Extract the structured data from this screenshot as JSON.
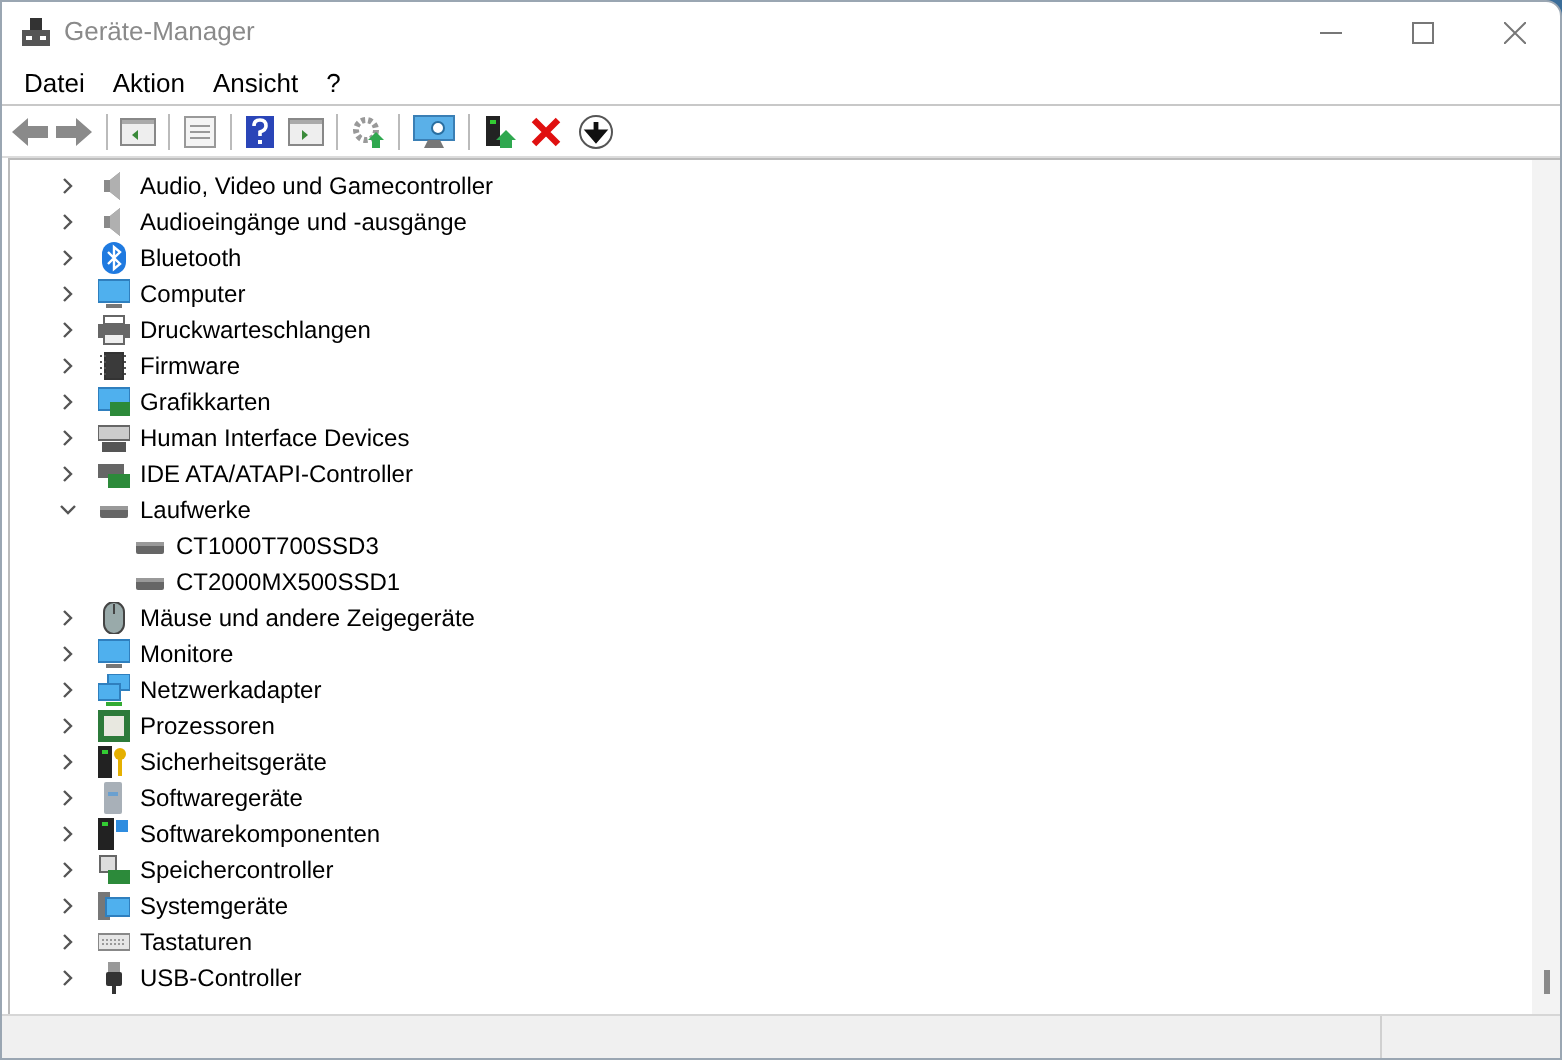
{
  "window": {
    "title": "Geräte-Manager"
  },
  "menu": [
    "Datei",
    "Aktion",
    "Ansicht",
    "?"
  ],
  "tree": [
    {
      "label": "Audio, Video und Gamecontroller",
      "expanded": false
    },
    {
      "label": "Audioeingänge und -ausgänge",
      "expanded": false
    },
    {
      "label": "Bluetooth",
      "expanded": false
    },
    {
      "label": "Computer",
      "expanded": false
    },
    {
      "label": "Druckwarteschlangen",
      "expanded": false
    },
    {
      "label": "Firmware",
      "expanded": false
    },
    {
      "label": "Grafikkarten",
      "expanded": false
    },
    {
      "label": "Human Interface Devices",
      "expanded": false
    },
    {
      "label": "IDE ATA/ATAPI-Controller",
      "expanded": false
    },
    {
      "label": "Laufwerke",
      "expanded": true,
      "children": [
        {
          "label": "CT1000T700SSD3"
        },
        {
          "label": "CT2000MX500SSD1"
        }
      ]
    },
    {
      "label": "Mäuse und andere Zeigegeräte",
      "expanded": false
    },
    {
      "label": "Monitore",
      "expanded": false
    },
    {
      "label": "Netzwerkadapter",
      "expanded": false
    },
    {
      "label": "Prozessoren",
      "expanded": false
    },
    {
      "label": "Sicherheitsgeräte",
      "expanded": false
    },
    {
      "label": "Softwaregeräte",
      "expanded": false
    },
    {
      "label": "Softwarekomponenten",
      "expanded": false
    },
    {
      "label": "Speichercontroller",
      "expanded": false
    },
    {
      "label": "Systemgeräte",
      "expanded": false
    },
    {
      "label": "Tastaturen",
      "expanded": false
    },
    {
      "label": "USB-Controller",
      "expanded": false
    }
  ]
}
